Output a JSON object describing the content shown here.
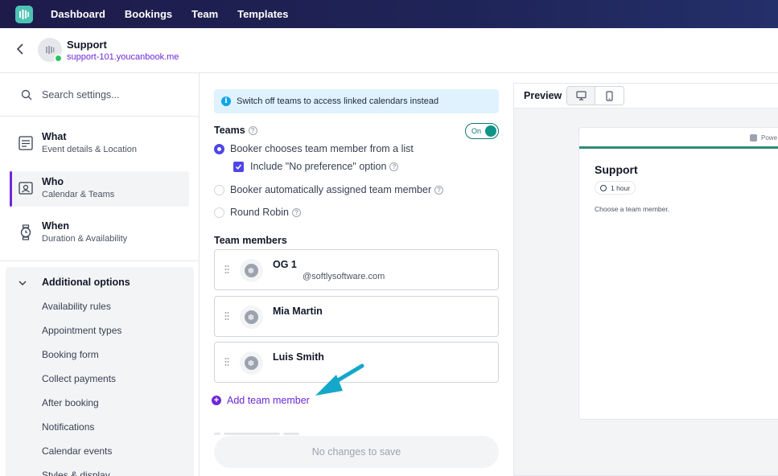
{
  "nav": {
    "items": [
      "Dashboard",
      "Bookings",
      "Team",
      "Templates"
    ]
  },
  "header": {
    "title": "Support",
    "link": "support-101.youcanbook.me"
  },
  "sidebar": {
    "search_placeholder": "Search settings...",
    "sections": [
      {
        "title": "What",
        "subtitle": "Event details & Location"
      },
      {
        "title": "Who",
        "subtitle": "Calendar & Teams"
      },
      {
        "title": "When",
        "subtitle": "Duration & Availability"
      }
    ],
    "additional": {
      "title": "Additional options",
      "items": [
        "Availability rules",
        "Appointment types",
        "Booking form",
        "Collect payments",
        "After booking",
        "Notifications",
        "Calendar events",
        "Styles & display"
      ]
    }
  },
  "main": {
    "info": "Switch off teams to access linked calendars instead",
    "teams_label": "Teams",
    "toggle_label": "On",
    "options": {
      "list": "Booker chooses team member from a list",
      "no_pref": "Include \"No preference\" option",
      "auto": "Booker automatically assigned team member",
      "round_robin": "Round Robin"
    },
    "team_members_label": "Team members",
    "members": [
      {
        "name": "OG 1",
        "email": "@softlysoftware.com"
      },
      {
        "name": "Mia Martin",
        "email": ""
      },
      {
        "name": "Luis Smith",
        "email": ""
      }
    ],
    "add_member": "Add team member",
    "save_button": "No changes to save"
  },
  "preview": {
    "label": "Preview",
    "powered": "Powe",
    "title": "Support",
    "duration": "1 hour",
    "text": "Choose a team member."
  },
  "colors": {
    "nav_bg": "#1e1b4b",
    "accent": "#6d28d9",
    "toggle": "#0f9488",
    "preview_stripe": "#2e8b74",
    "arrow": "#14a7c9"
  }
}
